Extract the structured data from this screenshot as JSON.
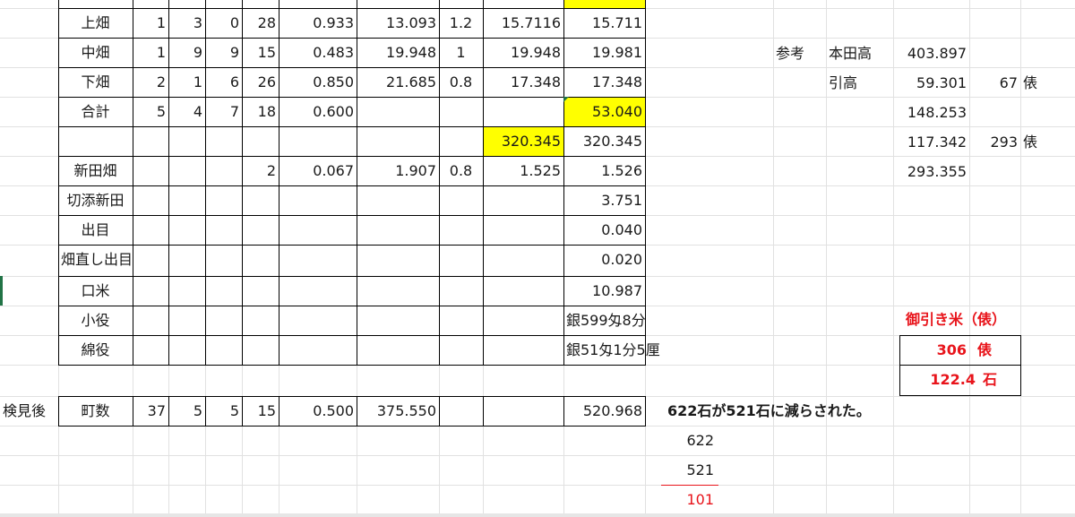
{
  "rows": [
    {
      "name": "row-kamihata",
      "cells": {
        "b": "上畑",
        "c": "1",
        "d": "3",
        "e": "0",
        "f": "28",
        "g": "0.933",
        "h": "13.093",
        "i": "1.2",
        "j": "15.7116",
        "k": "15.711"
      }
    },
    {
      "name": "row-nakahata",
      "cells": {
        "b": "中畑",
        "c": "1",
        "d": "9",
        "e": "9",
        "f": "15",
        "g": "0.483",
        "h": "19.948",
        "i": "1",
        "j": "19.948",
        "k": "19.981"
      }
    },
    {
      "name": "row-shimohata",
      "cells": {
        "b": "下畑",
        "c": "2",
        "d": "1",
        "e": "6",
        "f": "26",
        "g": "0.850",
        "h": "21.685",
        "i": "0.8",
        "j": "17.348",
        "k": "17.348"
      }
    },
    {
      "name": "row-goukei",
      "cells": {
        "b": "合計",
        "c": "5",
        "d": "4",
        "e": "7",
        "f": "18",
        "g": "0.600",
        "k": "53.040"
      }
    },
    {
      "name": "row-subtotal",
      "cells": {
        "j": "320.345",
        "k": "320.345"
      }
    },
    {
      "name": "row-shindenhata",
      "cells": {
        "b": "新田畑",
        "f": "2",
        "g": "0.067",
        "h": "1.907",
        "i": "0.8",
        "j": "1.525",
        "k": "1.526"
      }
    },
    {
      "name": "row-kirizoe",
      "cells": {
        "b": "切添新田",
        "k": "3.751"
      }
    },
    {
      "name": "row-deme",
      "cells": {
        "b": "出目",
        "k": "0.040"
      }
    },
    {
      "name": "row-hatanaoshi",
      "cells": {
        "b": "畑直し出目",
        "k": "0.020"
      }
    },
    {
      "name": "row-kuchimai",
      "cells": {
        "b": "口米",
        "k": "10.987"
      }
    },
    {
      "name": "row-koyaku",
      "cells": {
        "b": "小役",
        "k": "銀599匁8分"
      }
    },
    {
      "name": "row-wataku",
      "cells": {
        "b": "綿役",
        "k": "銀51匁1分5厘"
      }
    },
    {
      "name": "row-blank",
      "cells": {}
    },
    {
      "name": "row-kenmigo",
      "cells": {
        "a": "検見後",
        "b": "町数",
        "c": "37",
        "d": "5",
        "e": "5",
        "f": "15",
        "g": "0.500",
        "h": "375.550",
        "k": "520.968"
      }
    }
  ],
  "reference": {
    "label": "参考",
    "honden_label": "本田高",
    "honden_value": "403.897",
    "hikidaka_label": "引高",
    "hikidaka_value": "59.301",
    "hikidaka_bales": "67",
    "bale_unit": "俵",
    "value_3": "148.253",
    "value_4": "117.342",
    "value_4_bales": "293",
    "value_5": "293.355"
  },
  "ohikimai": {
    "title": "御引き米（俵）",
    "bales_value": "306",
    "bales_unit": "俵",
    "koku_value": "122.4",
    "koku_unit": "石"
  },
  "note": "622石が521石に減らされた。",
  "calc": {
    "a": "622",
    "b": "521",
    "diff": "101"
  },
  "colors": {
    "highlight": "#ffff00",
    "red": "#e8141b",
    "gridline": "#e1e1e1",
    "selection": "#217346"
  }
}
